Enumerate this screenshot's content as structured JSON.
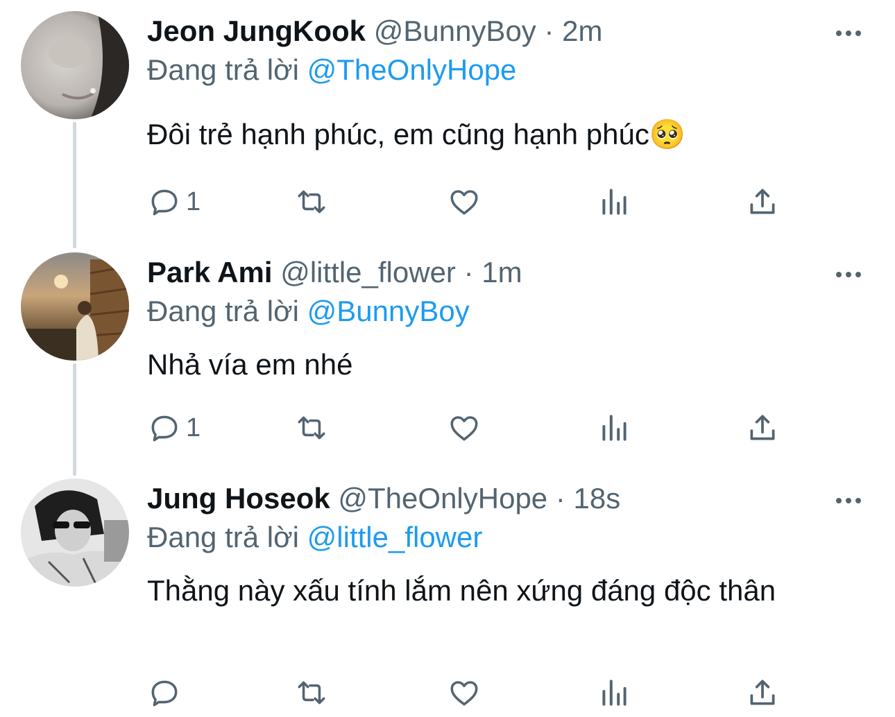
{
  "tweets": [
    {
      "name": "Jeon JungKook",
      "handle": "@BunnyBoy",
      "separator": "·",
      "time": "2m",
      "reply_prefix": "Đang trả lời",
      "reply_to": "@TheOnlyHope",
      "text": "Đôi trẻ hạnh phúc, em cũng hạnh phúc🥺",
      "reply_count": "1"
    },
    {
      "name": "Park Ami",
      "handle": "@little_flower",
      "separator": "·",
      "time": "1m",
      "reply_prefix": "Đang trả lời",
      "reply_to": "@BunnyBoy",
      "text": "Nhả vía em nhé",
      "reply_count": "1"
    },
    {
      "name": "Jung Hoseok",
      "handle": "@TheOnlyHope",
      "separator": "·",
      "time": "18s",
      "reply_prefix": "Đang trả lời",
      "reply_to": "@little_flower",
      "text": "Thằng này xấu tính lắm nên xứng đáng độc thân",
      "reply_count": ""
    }
  ],
  "icons": {
    "reply": "comment-icon",
    "retweet": "retweet-icon",
    "like": "heart-icon",
    "views": "analytics-icon",
    "share": "share-icon",
    "more": "more-icon"
  },
  "colors": {
    "text": "#0f1419",
    "secondary": "#536471",
    "mention": "#1d9bf0",
    "thread_line": "#cfd9de"
  }
}
